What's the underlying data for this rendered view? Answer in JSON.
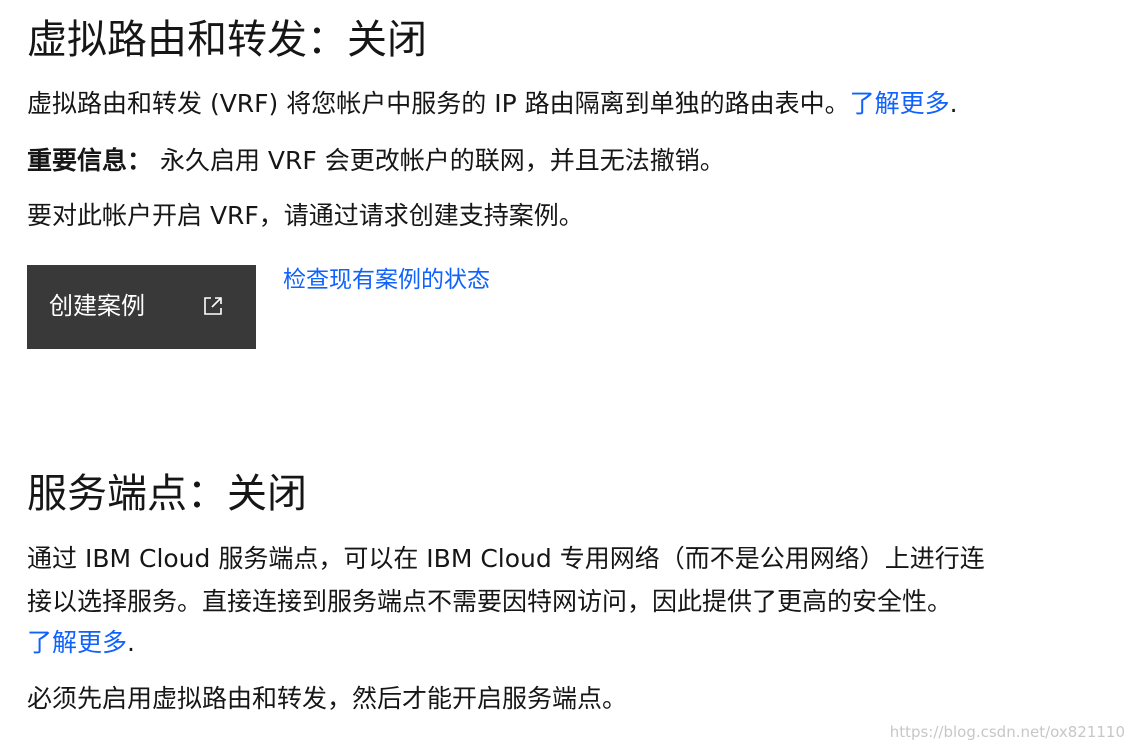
{
  "vrf": {
    "title": "虚拟路由和转发：关闭",
    "description": "虚拟路由和转发 (VRF) 将您帐户中服务的 IP 路由隔离到单独的路由表中。",
    "learn_more": "了解更多",
    "learn_more_suffix": ".",
    "important_label": "重要信息：",
    "important_text": "永久启用 VRF 会更改帐户的联网，并且无法撤销。",
    "instruction": "要对此帐户开启 VRF，请通过请求创建支持案例。",
    "create_case_button": "创建案例",
    "create_case_icon": "launch-external-icon",
    "check_status_link": "检查现有案例的状态"
  },
  "service_endpoint": {
    "title": "服务端点：关闭",
    "description_line1": "通过 IBM Cloud 服务端点，可以在 IBM Cloud 专用网络（而不是公用网络）上进行连",
    "description_line2": "接以选择服务。直接连接到服务端点不需要因特网访问，因此提供了更高的安全性。",
    "learn_more": "了解更多",
    "learn_more_suffix": ".",
    "requirement": "必须先启用虚拟路由和转发，然后才能开启服务端点。"
  },
  "watermark": "https://blog.csdn.net/ox821110",
  "colors": {
    "link": "#0f62fe",
    "button_bg": "#393939",
    "text": "#161616"
  }
}
